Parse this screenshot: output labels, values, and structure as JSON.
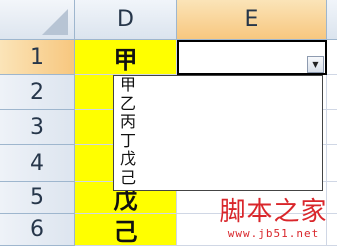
{
  "columns": {
    "d": "D",
    "e": "E"
  },
  "rows": [
    {
      "num": "1",
      "d": "甲",
      "e": ""
    },
    {
      "num": "2",
      "d": "",
      "e": ""
    },
    {
      "num": "3",
      "d": "",
      "e": ""
    },
    {
      "num": "4",
      "d": "",
      "e": ""
    },
    {
      "num": "5",
      "d": "戊",
      "e": ""
    },
    {
      "num": "6",
      "d": "己",
      "e": ""
    }
  ],
  "dropdown": {
    "options": [
      "甲",
      "乙",
      "丙",
      "丁",
      "戊",
      "己"
    ],
    "arrow_icon": "triangle-down-icon"
  },
  "watermark": {
    "title": "脚本之家",
    "url": "www.jb51.net"
  },
  "colors": {
    "highlight_yellow": "#ffff00",
    "active_header": "#f7c77f",
    "watermark_red": "#d9262b"
  }
}
